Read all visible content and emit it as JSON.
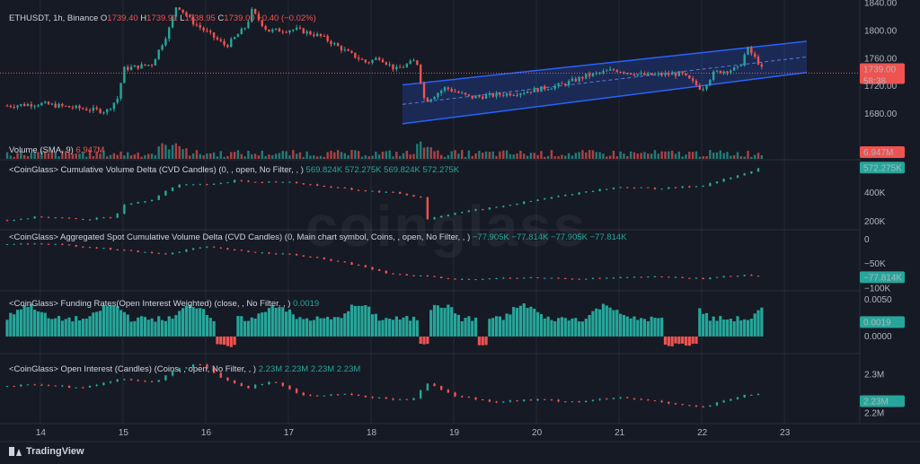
{
  "watermark": "coinglass",
  "branding": "TradingView",
  "colors": {
    "up": "#26a69a",
    "down": "#ef5350",
    "channel": "#2962ff",
    "bg": "#161a25",
    "grid": "#252a36"
  },
  "chart_data": {
    "type": "candlestick",
    "symbol_label": "ETHUSDT, 1h, Binance",
    "ohlc_label": {
      "o": "O1739.40",
      "h": "H1739.91",
      "l": "L1738.95",
      "c": "C1739.00",
      "chg": "−0.40 (−0.02%)"
    },
    "x_ticks": [
      "14",
      "15",
      "16",
      "17",
      "18",
      "19",
      "20",
      "21",
      "22",
      "23"
    ],
    "x_range": [
      13.6,
      23.9
    ],
    "panels": [
      {
        "id": "price",
        "ylim": [
          1640,
          1842
        ],
        "ticks": [
          "1840.00",
          "1800.00",
          "1760.00",
          "1720.00",
          "1680.00"
        ],
        "tick_values": [
          1840,
          1800,
          1760,
          1720,
          1680
        ],
        "last": "1739.00",
        "countdown": "58:38",
        "anchors": [
          [
            13.6,
            1692
          ],
          [
            14.0,
            1695
          ],
          [
            14.5,
            1688
          ],
          [
            14.8,
            1684
          ],
          [
            14.95,
            1705
          ],
          [
            15.0,
            1745
          ],
          [
            15.35,
            1752
          ],
          [
            15.55,
            1800
          ],
          [
            15.65,
            1838
          ],
          [
            15.85,
            1812
          ],
          [
            16.05,
            1795
          ],
          [
            16.25,
            1778
          ],
          [
            16.5,
            1808
          ],
          [
            16.55,
            1830
          ],
          [
            16.75,
            1800
          ],
          [
            17.1,
            1802
          ],
          [
            17.4,
            1792
          ],
          [
            17.7,
            1770
          ],
          [
            17.95,
            1754
          ],
          [
            18.1,
            1762
          ],
          [
            18.3,
            1744
          ],
          [
            18.55,
            1758
          ],
          [
            18.65,
            1698
          ],
          [
            18.9,
            1718
          ],
          [
            19.2,
            1704
          ],
          [
            19.55,
            1708
          ],
          [
            19.85,
            1712
          ],
          [
            20.3,
            1722
          ],
          [
            20.6,
            1735
          ],
          [
            20.95,
            1744
          ],
          [
            21.3,
            1736
          ],
          [
            21.75,
            1738
          ],
          [
            22.0,
            1716
          ],
          [
            22.15,
            1740
          ],
          [
            22.45,
            1746
          ],
          [
            22.55,
            1775
          ],
          [
            22.7,
            1752
          ],
          [
            22.75,
            1739
          ]
        ],
        "channel": {
          "upper": [
            [
              18.38,
              1722
            ],
            [
              23.27,
              1785
            ]
          ],
          "lower": [
            [
              18.38,
              1666
            ],
            [
              23.27,
              1740
            ]
          ]
        }
      },
      {
        "id": "volume",
        "title": "Volume (SMA, 9)",
        "value": "6.947M",
        "ylim": [
          0,
          1
        ]
      },
      {
        "id": "cvd",
        "title": "<CoinGlass> Cumulative Volume Delta (CVD Candles) (0, , open, No Filter, , )",
        "values": "569.824K  572.275K  569.824K  572.275K",
        "ylim": [
          150,
          630
        ],
        "ticks": [
          "400K",
          "200K"
        ],
        "tick_values": [
          400,
          200
        ],
        "last": "572.275K",
        "anchors": [
          [
            13.6,
            210
          ],
          [
            14.0,
            235
          ],
          [
            14.5,
            215
          ],
          [
            14.9,
            230
          ],
          [
            15.0,
            320
          ],
          [
            15.35,
            355
          ],
          [
            15.55,
            420
          ],
          [
            15.7,
            465
          ],
          [
            16.0,
            455
          ],
          [
            16.4,
            490
          ],
          [
            16.6,
            470
          ],
          [
            16.9,
            480
          ],
          [
            17.3,
            455
          ],
          [
            17.8,
            420
          ],
          [
            18.3,
            400
          ],
          [
            18.6,
            370
          ],
          [
            18.65,
            215
          ],
          [
            19.0,
            260
          ],
          [
            19.5,
            300
          ],
          [
            20.0,
            350
          ],
          [
            20.6,
            410
          ],
          [
            21.0,
            440
          ],
          [
            21.5,
            430
          ],
          [
            22.0,
            450
          ],
          [
            22.5,
            530
          ],
          [
            22.7,
            575
          ],
          [
            22.75,
            565
          ]
        ]
      },
      {
        "id": "spot",
        "title": "<CoinGlass> Aggregated Spot Cumulative Volume Delta (CVD Candles) (0, Main chart symbol, Coins, , open, No Filter, , )",
        "values": "−77.905K  −77.814K  −77.905K  −77.814K",
        "ylim": [
          -103,
          20
        ],
        "ticks": [
          "0",
          "−50K",
          "−100K"
        ],
        "tick_values": [
          0,
          -50,
          -100
        ],
        "last": "−77.814K",
        "anchors": [
          [
            13.6,
            -10
          ],
          [
            14.0,
            -8
          ],
          [
            14.5,
            -14
          ],
          [
            15.0,
            -22
          ],
          [
            15.5,
            -30
          ],
          [
            15.8,
            -20
          ],
          [
            16.0,
            -15
          ],
          [
            16.5,
            -25
          ],
          [
            17.0,
            -30
          ],
          [
            17.5,
            -42
          ],
          [
            17.9,
            -55
          ],
          [
            18.2,
            -70
          ],
          [
            18.65,
            -75
          ],
          [
            19.0,
            -82
          ],
          [
            19.5,
            -79
          ],
          [
            20.0,
            -78
          ],
          [
            20.5,
            -80
          ],
          [
            21.0,
            -78
          ],
          [
            21.5,
            -76
          ],
          [
            22.0,
            -80
          ],
          [
            22.5,
            -72
          ],
          [
            22.7,
            -74
          ],
          [
            22.75,
            -78
          ]
        ]
      },
      {
        "id": "funding",
        "title": "<CoinGlass> Funding Rates(Open Interest Weighted) (close, , No Filter, , )",
        "values": "0.0019",
        "ylim": [
          -0.0022,
          0.0062
        ],
        "ticks": [
          "0.0050",
          "0.0000"
        ],
        "tick_values": [
          0.005,
          0
        ],
        "last": "0.0019"
      },
      {
        "id": "oi",
        "title": "<CoinGlass> Open Interest (Candles) (Coins, , open, No Filter, , )",
        "values": "2.23M  2.23M  2.23M  2.23M",
        "ylim": [
          2.175,
          2.355
        ],
        "ticks": [
          "2.3M",
          "2.2M"
        ],
        "tick_values": [
          2.3,
          2.2
        ],
        "last": "2.23M",
        "anchors": [
          [
            13.6,
            2.27
          ],
          [
            14.0,
            2.275
          ],
          [
            14.5,
            2.265
          ],
          [
            15.0,
            2.29
          ],
          [
            15.4,
            2.28
          ],
          [
            15.6,
            2.31
          ],
          [
            15.9,
            2.33
          ],
          [
            16.2,
            2.29
          ],
          [
            16.5,
            2.265
          ],
          [
            16.8,
            2.285
          ],
          [
            17.2,
            2.245
          ],
          [
            17.6,
            2.25
          ],
          [
            18.0,
            2.24
          ],
          [
            18.5,
            2.235
          ],
          [
            18.7,
            2.28
          ],
          [
            19.0,
            2.245
          ],
          [
            19.5,
            2.23
          ],
          [
            20.0,
            2.235
          ],
          [
            20.5,
            2.23
          ],
          [
            21.0,
            2.24
          ],
          [
            21.5,
            2.23
          ],
          [
            22.0,
            2.215
          ],
          [
            22.5,
            2.245
          ],
          [
            22.7,
            2.25
          ],
          [
            22.75,
            2.23
          ]
        ]
      }
    ]
  }
}
